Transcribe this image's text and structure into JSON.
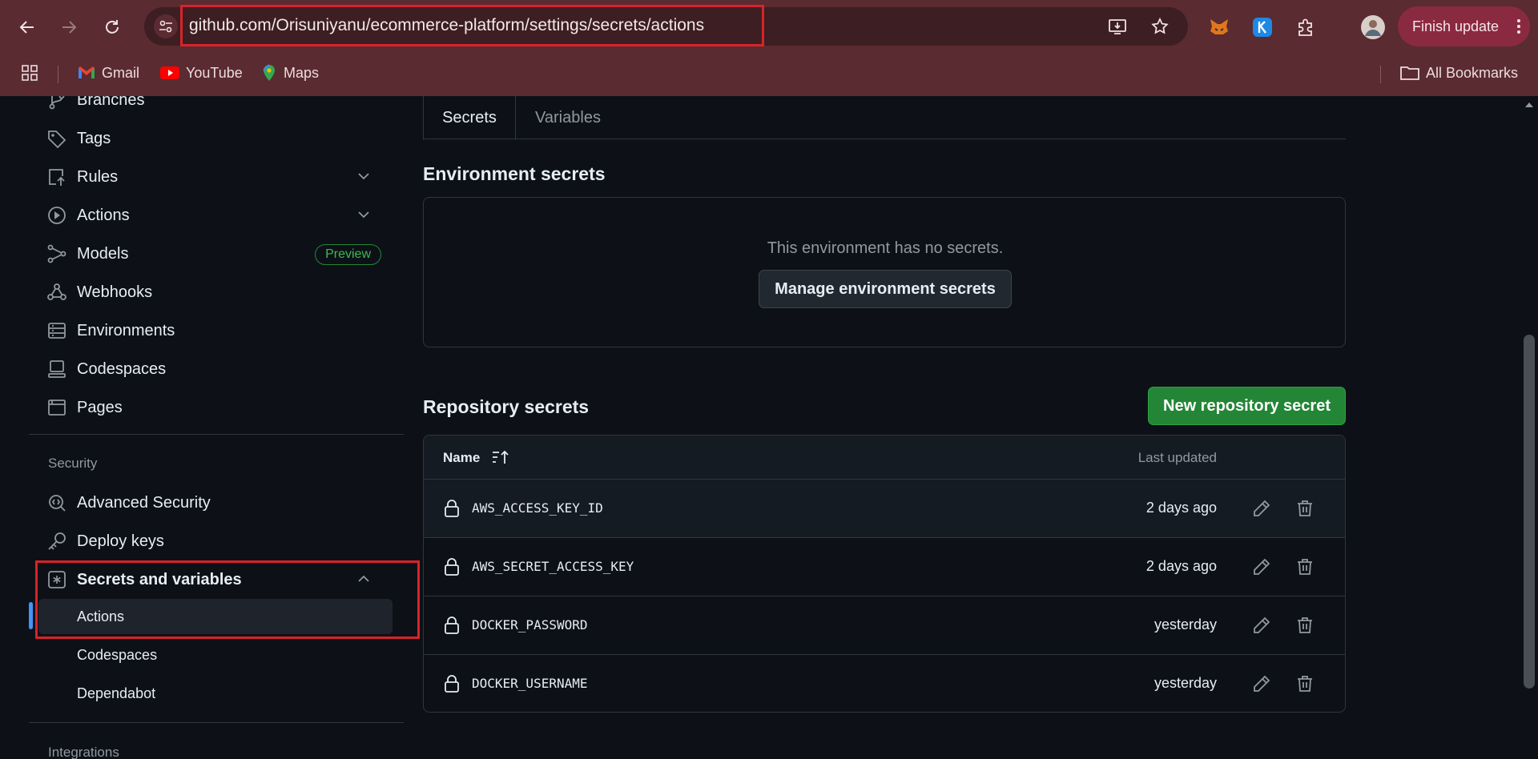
{
  "browser": {
    "url": "github.com/Orisuniyanu/ecommerce-platform/settings/secrets/actions",
    "finish_update_label": "Finish update",
    "bookmarks": [
      {
        "label": "Gmail",
        "icon": "gmail-icon"
      },
      {
        "label": "YouTube",
        "icon": "youtube-icon"
      },
      {
        "label": "Maps",
        "icon": "maps-icon"
      }
    ],
    "all_bookmarks_label": "All Bookmarks",
    "accent_color": "#5a2b30"
  },
  "sidebar": {
    "items": [
      {
        "label": "Branches",
        "icon": "branch-icon"
      },
      {
        "label": "Tags",
        "icon": "tag-icon"
      },
      {
        "label": "Rules",
        "icon": "rules-icon"
      },
      {
        "label": "Actions",
        "icon": "play-icon"
      },
      {
        "label": "Models",
        "icon": "models-icon",
        "badge": "Preview"
      },
      {
        "label": "Webhooks",
        "icon": "webhook-icon"
      },
      {
        "label": "Environments",
        "icon": "server-icon"
      },
      {
        "label": "Codespaces",
        "icon": "codespaces-icon"
      },
      {
        "label": "Pages",
        "icon": "browser-icon"
      }
    ],
    "security_heading": "Security",
    "security_items": [
      {
        "label": "Advanced Security",
        "icon": "codescan-icon"
      },
      {
        "label": "Deploy keys",
        "icon": "key-icon"
      },
      {
        "label": "Secrets and variables",
        "icon": "asterisk-icon"
      }
    ],
    "secrets_sub_items": [
      "Actions",
      "Codespaces",
      "Dependabot"
    ],
    "integrations_heading": "Integrations"
  },
  "main": {
    "tabs": [
      "Secrets",
      "Variables"
    ],
    "env_secrets_title": "Environment secrets",
    "env_empty_text": "This environment has no secrets.",
    "manage_env_button": "Manage environment secrets",
    "repo_secrets_title": "Repository secrets",
    "new_secret_button": "New repository secret",
    "table": {
      "col_name": "Name",
      "col_updated": "Last updated",
      "rows": [
        {
          "name": "AWS_ACCESS_KEY_ID",
          "updated": "2 days ago"
        },
        {
          "name": "AWS_SECRET_ACCESS_KEY",
          "updated": "2 days ago"
        },
        {
          "name": "DOCKER_PASSWORD",
          "updated": "yesterday"
        },
        {
          "name": "DOCKER_USERNAME",
          "updated": "yesterday"
        }
      ]
    }
  },
  "colors": {
    "primary_button": "#238636",
    "active_indicator": "#4493f8",
    "annotation_red": "#d8232a"
  }
}
